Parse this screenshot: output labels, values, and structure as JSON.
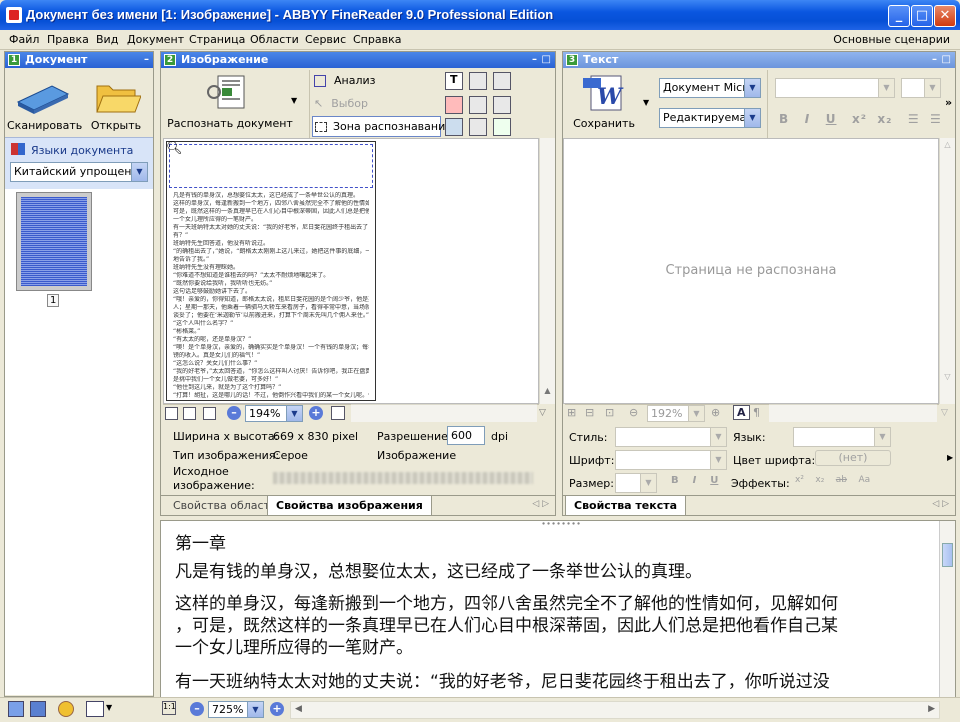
{
  "window": {
    "title": "Документ без имени [1: Изображение] - ABBYY FineReader 9.0 Professional Edition"
  },
  "menu": {
    "items": [
      "Файл",
      "Правка",
      "Вид",
      "Документ",
      "Страница",
      "Области",
      "Сервис",
      "Справка"
    ],
    "scenarios": "Основные сценарии"
  },
  "doc_pane": {
    "num": "1",
    "title": "Документ",
    "scan": "Сканировать",
    "open": "Открыть",
    "langs_label": "Языки документа",
    "lang_value": "Китайский упрощен...",
    "page_num": "1"
  },
  "image_pane": {
    "num": "2",
    "title": "Изображение",
    "recognize": "Распознать документ",
    "analyze": "Анализ",
    "select": "Выбор",
    "zone": "Зона распознавания",
    "zoom": "194%",
    "props": {
      "size_label": "Ширина x высота:",
      "size_value": "669 x 830 pixel",
      "res_label": "Разрешение:",
      "res_value": "600",
      "res_unit": "dpi",
      "type_label": "Тип изображения:",
      "type_value": "Серое",
      "type_value2": "Изображение",
      "source_label": "Исходное изображение:"
    },
    "tabs": [
      "Свойства области",
      "Свойства изображения"
    ]
  },
  "text_pane": {
    "num": "3",
    "title": "Текст",
    "save": "Сохранить",
    "format": "Документ Micro",
    "edit_mode": "Редактируемая",
    "empty": "Страница не распознана",
    "zoom": "192%",
    "props": {
      "style": "Стиль:",
      "lang": "Язык:",
      "font": "Шрифт:",
      "font_color": "Цвет шрифта:",
      "color_value": "(нет)",
      "size": "Размер:",
      "effects": "Эффекты:"
    },
    "tab": "Свойства текста"
  },
  "zoom_pane": {
    "zoom": "725%",
    "lines": [
      "第一章",
      "凡是有钱的单身汉，总想娶位太太，这已经成了一条举世公认的真理。",
      "这样的单身汉，每逢新搬到一个地方，四邻八舍虽然完全不了解他的性情如何，见解如何",
      "，可是，既然这样的一条真理早已在人们心目中根深蒂固，因此人们总是把他看作自己某",
      "一个女儿理所应得的一笔财产。",
      "有一天班纳特太太对她的丈夫说：“我的好老爷，尼日斐花园终于租出去了，你听说过没"
    ]
  },
  "page_text_lines": [
    "凡是有钱的单身汉，总想娶位太太，这已经成了一条举世公认的真理。",
    "这样的单身汉，每逢新搬到一个地方，四邻八舍虽然完全不了解他的性情如何，见解如何",
    "可是，既然这样的一条真理早已在人们心目中根深蒂固，因此人们总是把他看作自己某",
    "一个女儿理所应得的一笔财产。",
    "有一天班纳特太太对她的丈夫说：“我的好老爷，尼日斐花园终于租出去了，你听说过没",
    "有？”",
    "班纳特先生回答道，他没有听说过。",
    "“的确租出去了，”她说，“朗格太太刚刚上这儿来过，她把这件事的底细，一五一十",
    "地告诉了我。”",
    "班纳特先生没有理睬她。",
    "“你难道不想知道是谁租去的吗？”太太不耐烦地嚷起来了。",
    "“既然你要说给我听，我听听也无妨。”",
    "这句话足够鼓励她讲下去了。",
    "“哦！亲爱的，你得知道，郎格太太说，租尼日斐花园的是个阔少爷，他是英格兰北部的",
    "人；星期一那天，他乘着一辆驷马大轿车来看房子，看得非常中意，当场就和莫理斯先生",
    "谈妥了；他要在‘米迦勒节’以前搬进来，打算下个周末先叫几个佣人来住。”",
    "“这个人叫什么名字？”",
    "“彬格莱。”",
    "“有太太的呢，还是单身汉？”",
    "“噢！是个单身汉，亲爱的，确确实实是个单身汉！一个有钱的单身汉；每年有四五千",
    "镑的收入。真是女儿们的福气！”",
    "“这怎么说？关女儿们什么事？”",
    "“我的好老爷，”太太回答道，“你怎么这样叫人讨厌！告诉你吧，我正在盘算，他要",
    "是挑中我们一个女儿做老婆，可多好！”",
    "“他住到这儿来，就是为了这个打算吗？”",
    "“打算！胡扯，这是哪儿的话！不过，他倒作兴看中我们的某一个女儿呢。他一搬来，你",
    "就得去拜访拜访他。”",
    "“我不用去。你带着女儿们去就得啦，要不你干脆打发她们自己去，那或许倒更好些，因",
    "为你跟女儿们比起来，她们哪一个都不能胜过你的美貌，你去了，彬格莱先生倒可能挑中",
    "你呢？”"
  ]
}
